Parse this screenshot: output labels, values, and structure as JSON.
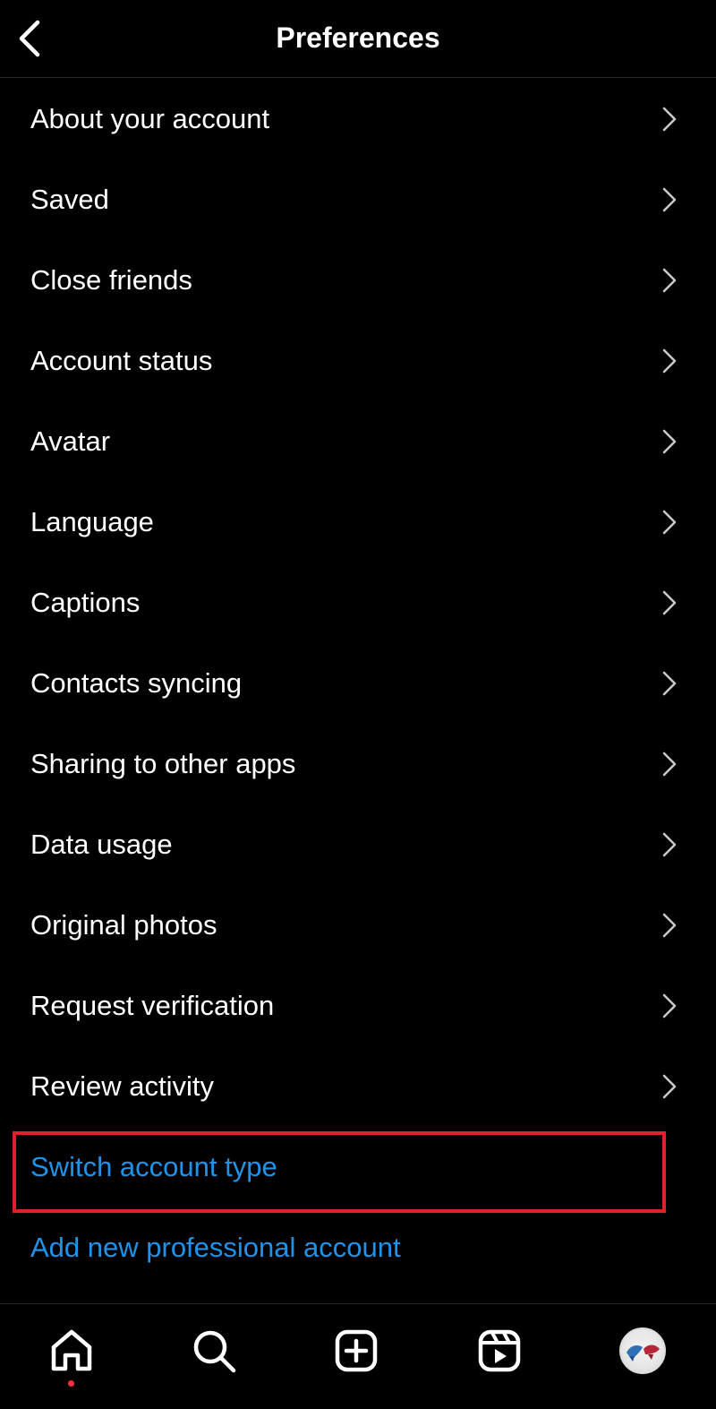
{
  "header": {
    "title": "Preferences"
  },
  "menu": {
    "items": [
      {
        "label": "About your account"
      },
      {
        "label": "Saved"
      },
      {
        "label": "Close friends"
      },
      {
        "label": "Account status"
      },
      {
        "label": "Avatar"
      },
      {
        "label": "Language"
      },
      {
        "label": "Captions"
      },
      {
        "label": "Contacts syncing"
      },
      {
        "label": "Sharing to other apps"
      },
      {
        "label": "Data usage"
      },
      {
        "label": "Original photos"
      },
      {
        "label": "Request verification"
      },
      {
        "label": "Review activity"
      }
    ],
    "links": [
      {
        "label": "Switch account type"
      },
      {
        "label": "Add new professional account"
      }
    ]
  },
  "tabbar": {
    "items": [
      "home-icon",
      "search-icon",
      "create-icon",
      "reels-icon",
      "profile-avatar"
    ]
  },
  "colors": {
    "background": "#000000",
    "link": "#1f93ea",
    "highlight": "#e0202c",
    "notification_dot": "#ff3040"
  }
}
